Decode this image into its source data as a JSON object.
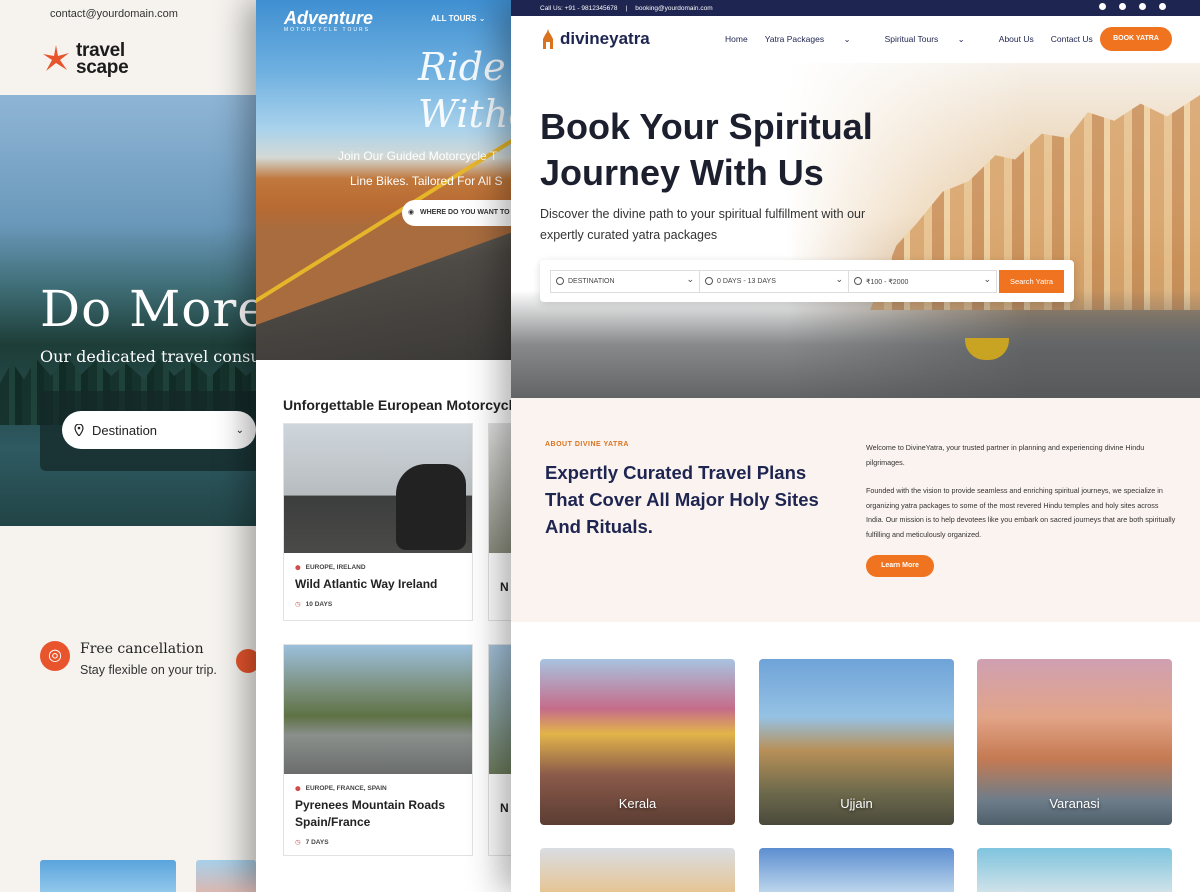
{
  "travelscape": {
    "contact_email": "contact@yourdomain.com",
    "logo_line1": "travel",
    "logo_line2": "scape",
    "hero_title": "Do More",
    "hero_subtitle": "Our dedicated travel consu",
    "search_placeholder": "Destination",
    "feature_title": "Free cancellation",
    "feature_subtitle": "Stay flexible on your trip.",
    "accent_color": "#e8552d"
  },
  "adventure": {
    "brand": "Adventure",
    "brand_tagline": "MOTORCYCLE TOURS",
    "nav_item": "ALL TOURS",
    "hero_title_line1": "Ride",
    "hero_title_line2": "Witho",
    "hero_lead_line1": "Join Our Guided Motorcycle T",
    "hero_lead_line2": "Line Bikes. Tailored For All S",
    "search_pill": "WHERE DO YOU WANT TO",
    "section_title": "Unforgettable European Motorcycle",
    "tours": [
      {
        "tags": "EUROPE, IRELAND",
        "name": "Wild Atlantic Way Ireland",
        "days": "10 DAYS"
      },
      {
        "tags": "EUROPE, FRANCE, SPAIN",
        "name": "Pyrenees Mountain Roads Spain/France",
        "days": "7 DAYS"
      }
    ],
    "partial_card_prefix": "N"
  },
  "divineyatra": {
    "topbar_call": "Call Us: +91 - 9812345678",
    "topbar_email": "booking@yourdomain.com",
    "logo_text": "divineyatra",
    "nav": [
      "Home",
      "Yatra Packages",
      "Spiritual Tours",
      "About Us",
      "Contact Us"
    ],
    "book_button": "BOOK YATRA",
    "hero_title_line1": "Book Your Spiritual",
    "hero_title_line2": "Journey With Us",
    "hero_lead_line1": "Discover the divine path to your spiritual fulfillment with our",
    "hero_lead_line2": "expertly curated yatra packages",
    "search": {
      "destination": "DESTINATION",
      "duration": "0 DAYS - 13 DAYS",
      "budget": "₹100 - ₹2000",
      "button": "Search Yatra"
    },
    "about_kicker": "ABOUT DIVINE YATRA",
    "about_title_line1": "Expertly Curated Travel Plans",
    "about_title_line2": "That Cover All Major Holy Sites",
    "about_title_line3": "And Rituals.",
    "about_p1": "Welcome to DivineYatra, your trusted partner in planning and experiencing divine Hindu pilgrimages.",
    "about_p2": "Founded with the vision to provide seamless and enriching spiritual journeys, we specialize in organizing yatra packages to some of the most revered Hindu temples and holy sites across India. Our mission is to help devotees like you embark on sacred journeys that are both spiritually fulfilling and meticulously organized.",
    "learn_more": "Learn More",
    "destinations": [
      "Kerala",
      "Ujjain",
      "Varanasi"
    ],
    "accent_color": "#f0731f",
    "navy_color": "#1e2550"
  }
}
